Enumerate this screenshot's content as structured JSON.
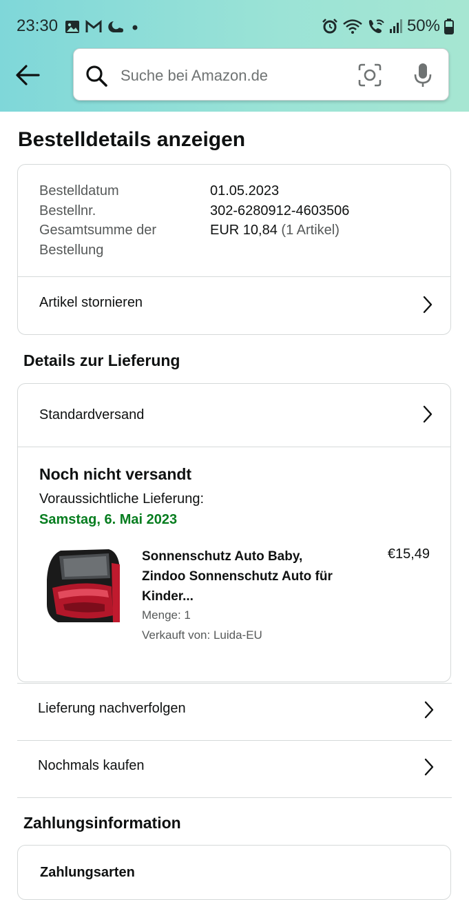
{
  "status_bar": {
    "time": "23:30",
    "battery": "50%",
    "left_icons": [
      "image-icon",
      "gmail-icon",
      "weather-icon",
      "dot-icon"
    ],
    "right_icons": [
      "alarm-icon",
      "wifi-icon",
      "wifi-call-icon",
      "signal-icon",
      "battery-icon"
    ]
  },
  "search": {
    "placeholder": "Suche bei Amazon.de"
  },
  "page": {
    "title": "Bestelldetails anzeigen"
  },
  "order_summary": {
    "date_label": "Bestelldatum",
    "date_value": "01.05.2023",
    "number_label": "Bestellnr.",
    "number_value": "302-6280912-4603506",
    "total_label_1": "Gesamtsumme der",
    "total_label_2": "Bestellung",
    "total_value": "EUR 10,84",
    "total_items": "(1 Artikel)",
    "cancel_label": "Artikel stornieren"
  },
  "delivery": {
    "section_title": "Details zur Lieferung",
    "shipping_method": "Standardversand",
    "status": "Noch nicht versandt",
    "eta_label": "Voraussichtliche Lieferung:",
    "eta_date": "Samstag, 6. Mai 2023",
    "product": {
      "title": "Sonnenschutz Auto Baby, Zindoo Sonnenschutz Auto für Kinder...",
      "price": "€15,49",
      "quantity": "Menge: 1",
      "seller": "Verkauft von: Luida-EU"
    }
  },
  "actions": {
    "track": "Lieferung nachverfolgen",
    "buy_again": "Nochmals kaufen"
  },
  "payment": {
    "section_title": "Zahlungsinformation",
    "methods_label": "Zahlungsarten"
  },
  "colors": {
    "eta_green": "#067d1f",
    "header_teal": "#8fdcd6"
  }
}
